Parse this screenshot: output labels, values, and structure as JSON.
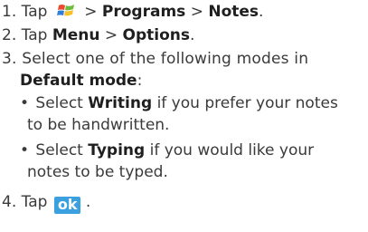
{
  "steps": {
    "s1": {
      "num": "1.",
      "tap": "Tap",
      "gt1": ">",
      "programs": "Programs",
      "gt2": ">",
      "notes": "Notes",
      "end": ".",
      "icon": "windows-start-icon"
    },
    "s2": {
      "num": "2.",
      "tap": "Tap",
      "menu": "Menu",
      "gt": ">",
      "options": "Options",
      "end": "."
    },
    "s3": {
      "line1": "3. Select one of the following modes in",
      "default_mode": "Default mode",
      "colon": ":"
    },
    "bullets": {
      "b1_pre": "Select",
      "b1_bold": "Writing",
      "b1_post": "if you prefer your notes",
      "b1_cont": "to be handwritten.",
      "b2_pre": "Select",
      "b2_bold": "Typing",
      "b2_post": "if you would like your",
      "b2_cont": "notes to be typed.",
      "bullet_char": "•"
    },
    "s4": {
      "num": "4.",
      "tap": "Tap",
      "ok": "ok",
      "end": "."
    }
  }
}
